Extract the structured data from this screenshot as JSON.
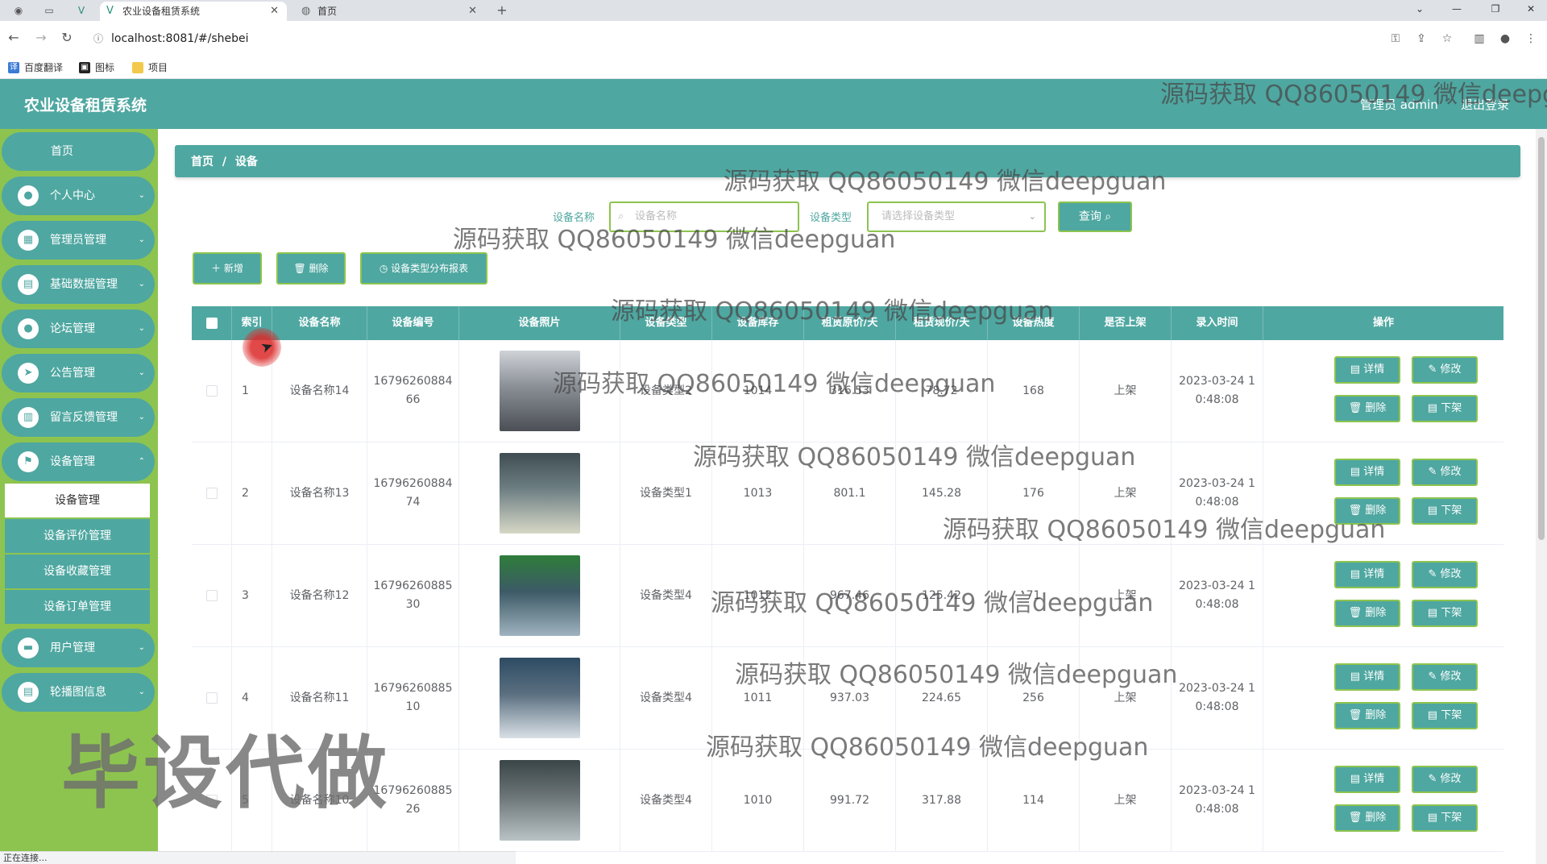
{
  "browser": {
    "tabs": [
      {
        "title": "农业设备租赁系统",
        "active": true
      },
      {
        "title": "首页",
        "active": false
      }
    ],
    "new_tab": "+",
    "url": "localhost:8081/#/shebei",
    "bookmarks": [
      "百度翻译",
      "图标",
      "项目"
    ],
    "status": "正在连接..."
  },
  "app": {
    "title": "农业设备租赁系统",
    "admin_label": "管理员 admin",
    "logout": "退出登录"
  },
  "sidebar": {
    "home": "首页",
    "items": [
      {
        "label": "个人中心",
        "icon": "user-icon"
      },
      {
        "label": "管理员管理",
        "icon": "grid-icon"
      },
      {
        "label": "基础数据管理",
        "icon": "chart-icon"
      },
      {
        "label": "论坛管理",
        "icon": "user-icon"
      },
      {
        "label": "公告管理",
        "icon": "send-icon"
      },
      {
        "label": "留言反馈管理",
        "icon": "chart-icon"
      },
      {
        "label": "设备管理",
        "icon": "flag-icon"
      },
      {
        "label": "用户管理",
        "icon": "box-icon"
      },
      {
        "label": "轮播图信息",
        "icon": "clipboard-icon"
      }
    ],
    "submenu": [
      "设备管理",
      "设备评价管理",
      "设备收藏管理",
      "设备订单管理"
    ]
  },
  "breadcrumb": [
    "首页",
    "/",
    "设备"
  ],
  "search": {
    "name_label": "设备名称",
    "name_placeholder": "设备名称",
    "type_label": "设备类型",
    "type_placeholder": "请选择设备类型",
    "query_button": "查询"
  },
  "actions": {
    "add": "新增",
    "delete": "删除",
    "report": "设备类型分布报表"
  },
  "table": {
    "columns": [
      "索引",
      "设备名称",
      "设备编号",
      "设备照片",
      "设备类型",
      "设备库存",
      "租赁原价/天",
      "租赁现价/天",
      "设备热度",
      "是否上架",
      "录入时间",
      "操作"
    ],
    "rows": [
      {
        "index": "1",
        "name": "设备名称14",
        "code1": "16796260884",
        "code2": "66",
        "type": "设备类型2",
        "stock": "1014",
        "orig_price": "316.53",
        "cur_price": "78.72",
        "heat": "168",
        "shelf": "上架",
        "time1": "2023-03-24 1",
        "time2": "0:48:08"
      },
      {
        "index": "2",
        "name": "设备名称13",
        "code1": "16796260884",
        "code2": "74",
        "type": "设备类型1",
        "stock": "1013",
        "orig_price": "801.1",
        "cur_price": "145.28",
        "heat": "176",
        "shelf": "上架",
        "time1": "2023-03-24 1",
        "time2": "0:48:08"
      },
      {
        "index": "3",
        "name": "设备名称12",
        "code1": "16796260885",
        "code2": "30",
        "type": "设备类型4",
        "stock": "1012",
        "orig_price": "967.46",
        "cur_price": "125.42",
        "heat": "71",
        "shelf": "上架",
        "time1": "2023-03-24 1",
        "time2": "0:48:08"
      },
      {
        "index": "4",
        "name": "设备名称11",
        "code1": "16796260885",
        "code2": "10",
        "type": "设备类型4",
        "stock": "1011",
        "orig_price": "937.03",
        "cur_price": "224.65",
        "heat": "256",
        "shelf": "上架",
        "time1": "2023-03-24 1",
        "time2": "0:48:08"
      },
      {
        "index": "5",
        "name": "设备名称10",
        "code1": "16796260885",
        "code2": "26",
        "type": "设备类型4",
        "stock": "1010",
        "orig_price": "991.72",
        "cur_price": "317.88",
        "heat": "114",
        "shelf": "上架",
        "time1": "2023-03-24 1",
        "time2": "0:48:08"
      }
    ],
    "op_labels": {
      "detail": "详情",
      "edit": "修改",
      "delete": "删除",
      "offshelf": "下架"
    }
  },
  "watermark": {
    "text": "源码获取 QQ86050149 微信deepguan",
    "header_text": "源码获取 QQ86050149 微信deepg",
    "big": "毕设代做"
  },
  "colors": {
    "primary": "#4fa7a1",
    "accent": "#8dc44f"
  }
}
